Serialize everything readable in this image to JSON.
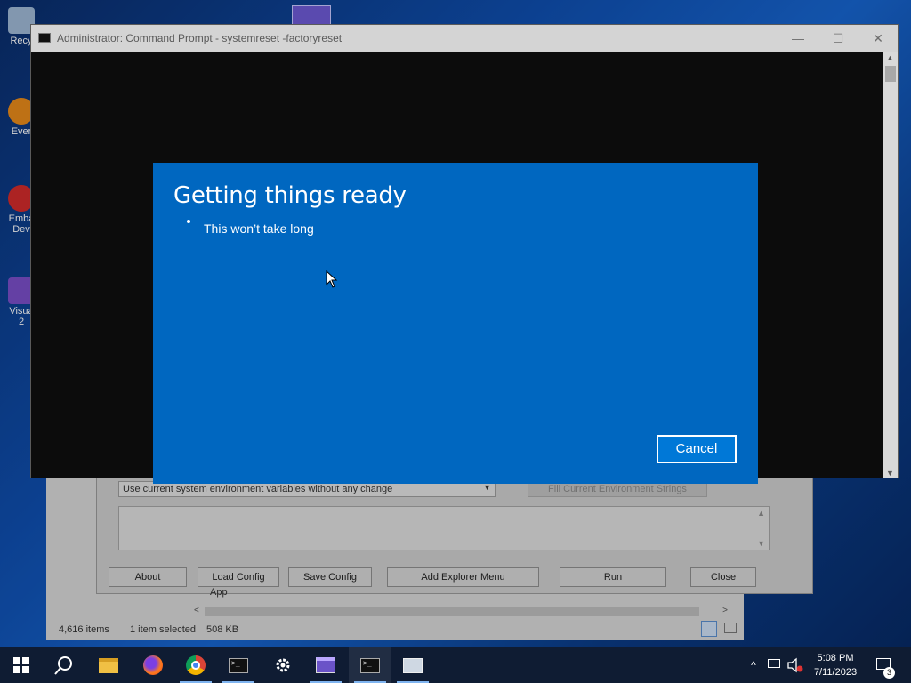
{
  "cmd_window": {
    "title": "Administrator: Command Prompt - systemreset  -factoryreset",
    "minimize": "—",
    "maximize": "☐",
    "close": "✕"
  },
  "reset_dialog": {
    "heading": "Getting things ready",
    "subtext": "This won’t take long",
    "cancel_label": "Cancel"
  },
  "tool_window": {
    "env_select_value": "Use current system environment variables without any change",
    "fill_button": "Fill Current Environment Strings",
    "buttons": {
      "about": "About",
      "load_config": "Load Config",
      "save_config": "Save Config",
      "add_explorer_menu": "Add Explorer Menu",
      "run": "Run",
      "close": "Close"
    }
  },
  "explorer": {
    "item_count": "4,616 items",
    "selected": "1 item selected",
    "selected_size": "508 KB",
    "row_partial": "App"
  },
  "desktop_icons": [
    {
      "label": "Recy"
    },
    {
      "label": "Ever"
    },
    {
      "label": "Emba\nDev"
    },
    {
      "label": "Visua\n2"
    }
  ],
  "taskbar": {
    "time": "5:08 PM",
    "date": "7/11/2023",
    "notification_count": "3",
    "apps": [
      "start-icon",
      "search-icon",
      "file-explorer-icon",
      "firefox-icon",
      "chrome-icon",
      "terminal-icon",
      "settings-icon",
      "app-icon",
      "cmd-icon",
      "window-icon"
    ]
  },
  "colors": {
    "dialog_blue": "#0067c0",
    "taskbar": "#0f1c33",
    "cmd_bg": "#0c0c0c"
  }
}
